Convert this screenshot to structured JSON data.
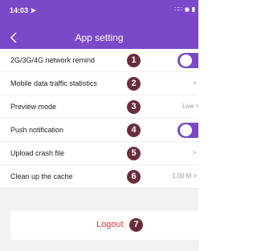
{
  "status_bar": {
    "time": "14:03 ➤",
    "indicators": "∷∷ ◉ ▮"
  },
  "header": {
    "title": "App setting",
    "back_icon": "chevron-left-icon"
  },
  "settings": {
    "rows": [
      {
        "label": "2G/3G/4G network remind",
        "marker": "1",
        "toggle_on": true
      },
      {
        "label": "Mobile data traffic statistics",
        "marker": "2",
        "value": ">"
      },
      {
        "label": "Preview mode",
        "marker": "3",
        "value": "Live >"
      },
      {
        "label": "Push notification",
        "marker": "4",
        "toggle_on": true
      },
      {
        "label": "Upload crash file",
        "marker": "5",
        "value": ">"
      },
      {
        "label": "Clean up the cache",
        "marker": "6",
        "value": "1.00 M >"
      }
    ]
  },
  "logout": {
    "label": "Logout",
    "marker": "7"
  },
  "colors": {
    "accent": "#7b48c7",
    "marker": "#6a2e3a",
    "logout_text": "#e53935"
  }
}
